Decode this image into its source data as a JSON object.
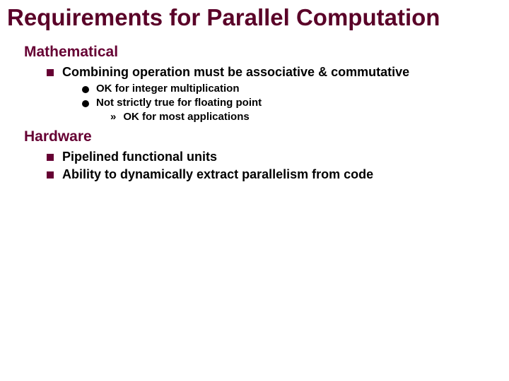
{
  "title": "Requirements for Parallel Computation",
  "sections": [
    {
      "heading": "Mathematical",
      "items": [
        {
          "text": "Combining operation must be associative & commutative",
          "sub": [
            {
              "text": "OK for integer multiplication",
              "sub": []
            },
            {
              "text": "Not strictly true for floating point",
              "sub": [
                {
                  "text": "OK for most applications"
                }
              ]
            }
          ]
        }
      ]
    },
    {
      "heading": "Hardware",
      "items": [
        {
          "text": "Pipelined functional units",
          "sub": []
        },
        {
          "text": "Ability to dynamically extract parallelism from code",
          "sub": []
        }
      ]
    }
  ]
}
